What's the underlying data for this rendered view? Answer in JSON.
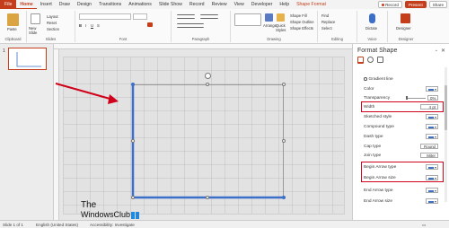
{
  "ribbon_tabs": [
    "File",
    "Home",
    "Insert",
    "Draw",
    "Design",
    "Transitions",
    "Animations",
    "Slide Show",
    "Record",
    "Review",
    "View",
    "Developer",
    "Help",
    "Shape Format"
  ],
  "tabbar_right": {
    "record_label": "Record",
    "present_label": "Present",
    "share_label": "Share"
  },
  "ribbon_groups": {
    "clipboard": {
      "label": "Clipboard",
      "paste": "Paste"
    },
    "slides": {
      "label": "Slides",
      "new_slide": "New Slide",
      "layout": "Layout",
      "reset": "Reset",
      "section": "Section"
    },
    "font": {
      "label": "Font"
    },
    "paragraph": {
      "label": "Paragraph"
    },
    "drawing": {
      "label": "Drawing",
      "arrange": "Arrange",
      "quick_styles": "Quick Styles",
      "shape_fill": "Shape Fill",
      "shape_outline": "Shape Outline",
      "shape_effects": "Shape Effects"
    },
    "editing": {
      "label": "Editing",
      "find": "Find",
      "replace": "Replace",
      "select": "Select"
    },
    "voice": {
      "label": "Voice",
      "dictate": "Dictate"
    },
    "designer": {
      "label": "Designer",
      "designer": "Designer"
    }
  },
  "thumbnail": {
    "number": "1"
  },
  "logo": {
    "line1": "The",
    "line2": "WindowsClub"
  },
  "format_pane": {
    "title": "Format Shape",
    "close_icon": "close-icon",
    "rows": [
      {
        "label": "Gradient line",
        "kind": "radio"
      },
      {
        "label": "Color",
        "kind": "swatch"
      },
      {
        "label": "Transparency",
        "kind": "slider",
        "value": "0%"
      },
      {
        "label": "Width",
        "kind": "spin",
        "value": "4 pt"
      },
      {
        "label": "Sketched style",
        "kind": "swatch"
      },
      {
        "label": "Compound type",
        "kind": "swatch"
      },
      {
        "label": "Dash type",
        "kind": "swatch"
      },
      {
        "label": "Cap type",
        "kind": "select",
        "value": "Round"
      },
      {
        "label": "Join type",
        "kind": "select",
        "value": "Miter"
      },
      {
        "label": "Begin Arrow type",
        "kind": "swatch"
      },
      {
        "label": "Begin Arrow size",
        "kind": "swatch"
      },
      {
        "label": "End Arrow type",
        "kind": "swatch"
      },
      {
        "label": "End Arrow size",
        "kind": "swatch"
      }
    ]
  },
  "status_bar": {
    "slide": "Slide 1 of 1",
    "language": "English (United States)",
    "accessibility": "Accessibility: Investigate"
  },
  "colors": {
    "accent": "#c43e1c",
    "shape_line": "#3b6fc8",
    "annotation": "#d0021b"
  }
}
